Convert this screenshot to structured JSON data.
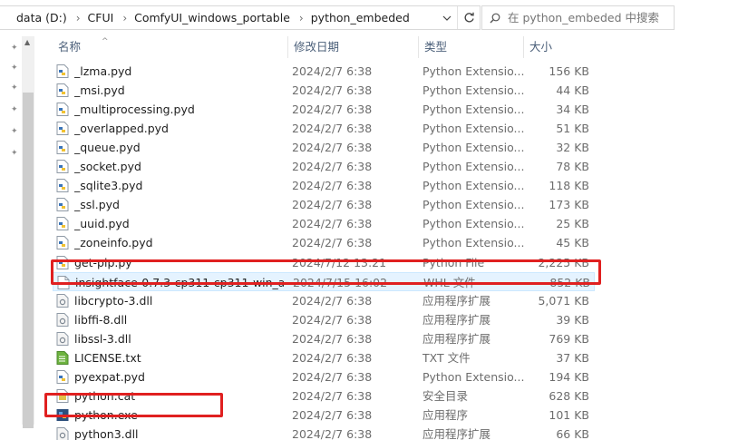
{
  "address": {
    "crumbs": [
      "data (D:)",
      "CFUI",
      "ComfyUI_windows_portable",
      "python_embeded"
    ]
  },
  "search": {
    "placeholder": "在 python_embeded 中搜索"
  },
  "columns": {
    "name": "名称",
    "date": "修改日期",
    "type": "类型",
    "size": "大小"
  },
  "files": [
    {
      "name": "_lzma.pyd",
      "date": "2024/2/7 6:38",
      "type": "Python Extensio...",
      "size": "156 KB",
      "icon": "pyd-file-icon"
    },
    {
      "name": "_msi.pyd",
      "date": "2024/2/7 6:38",
      "type": "Python Extensio...",
      "size": "44 KB",
      "icon": "pyd-file-icon"
    },
    {
      "name": "_multiprocessing.pyd",
      "date": "2024/2/7 6:38",
      "type": "Python Extensio...",
      "size": "34 KB",
      "icon": "pyd-file-icon"
    },
    {
      "name": "_overlapped.pyd",
      "date": "2024/2/7 6:38",
      "type": "Python Extensio...",
      "size": "51 KB",
      "icon": "pyd-file-icon"
    },
    {
      "name": "_queue.pyd",
      "date": "2024/2/7 6:38",
      "type": "Python Extensio...",
      "size": "32 KB",
      "icon": "pyd-file-icon"
    },
    {
      "name": "_socket.pyd",
      "date": "2024/2/7 6:38",
      "type": "Python Extensio...",
      "size": "78 KB",
      "icon": "pyd-file-icon"
    },
    {
      "name": "_sqlite3.pyd",
      "date": "2024/2/7 6:38",
      "type": "Python Extensio...",
      "size": "118 KB",
      "icon": "pyd-file-icon"
    },
    {
      "name": "_ssl.pyd",
      "date": "2024/2/7 6:38",
      "type": "Python Extensio...",
      "size": "173 KB",
      "icon": "pyd-file-icon"
    },
    {
      "name": "_uuid.pyd",
      "date": "2024/2/7 6:38",
      "type": "Python Extensio...",
      "size": "25 KB",
      "icon": "pyd-file-icon"
    },
    {
      "name": "_zoneinfo.pyd",
      "date": "2024/2/7 6:38",
      "type": "Python Extensio...",
      "size": "45 KB",
      "icon": "pyd-file-icon"
    },
    {
      "name": "get-pip.py",
      "date": "2024/7/12 13:21",
      "type": "Python File",
      "size": "2,225 KB",
      "icon": "python-file-icon"
    },
    {
      "name": "insightface-0.7.3-cp311-cp311-win_a...",
      "date": "2024/7/15 16:02",
      "type": "WHL 文件",
      "size": "852 KB",
      "icon": "blank-file-icon",
      "selected": true
    },
    {
      "name": "libcrypto-3.dll",
      "date": "2024/2/7 6:38",
      "type": "应用程序扩展",
      "size": "5,071 KB",
      "icon": "dll-file-icon"
    },
    {
      "name": "libffi-8.dll",
      "date": "2024/2/7 6:38",
      "type": "应用程序扩展",
      "size": "39 KB",
      "icon": "dll-file-icon"
    },
    {
      "name": "libssl-3.dll",
      "date": "2024/2/7 6:38",
      "type": "应用程序扩展",
      "size": "769 KB",
      "icon": "dll-file-icon"
    },
    {
      "name": "LICENSE.txt",
      "date": "2024/2/7 6:38",
      "type": "TXT 文件",
      "size": "37 KB",
      "icon": "text-file-icon"
    },
    {
      "name": "pyexpat.pyd",
      "date": "2024/2/7 6:38",
      "type": "Python Extensio...",
      "size": "194 KB",
      "icon": "pyd-file-icon"
    },
    {
      "name": "python.cat",
      "date": "2024/2/7 6:38",
      "type": "安全目录",
      "size": "628 KB",
      "icon": "catalog-file-icon"
    },
    {
      "name": "python.exe",
      "date": "2024/2/7 6:38",
      "type": "应用程序",
      "size": "101 KB",
      "icon": "python-exe-icon"
    },
    {
      "name": "python3.dll",
      "date": "2024/2/7 6:38",
      "type": "应用程序扩展",
      "size": "66 KB",
      "icon": "dll-file-icon"
    }
  ],
  "colors": {
    "highlight": "#e02020",
    "selection": "#e5f3ff",
    "header_text": "#4c607a"
  }
}
